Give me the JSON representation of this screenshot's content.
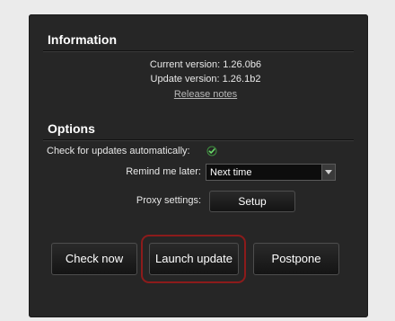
{
  "information": {
    "title": "Information",
    "current_version": "Current version: 1.26.0b6",
    "update_version": "Update version: 1.26.1b2",
    "release_notes": "Release notes"
  },
  "options": {
    "title": "Options",
    "auto_check_label": "Check for updates automatically:",
    "auto_check_checked": true,
    "remind_label": "Remind me later:",
    "remind_value": "Next time",
    "proxy_label": "Proxy settings:",
    "setup_button": "Setup"
  },
  "buttons": {
    "check_now": "Check now",
    "launch_update": "Launch update",
    "postpone": "Postpone"
  },
  "colors": {
    "panel_bg": "#262626",
    "check_green": "#5fd35f",
    "highlight_ring": "#8c1b1b"
  },
  "icons": {
    "checkbox": "checkmark-icon",
    "dropdown": "triangle-down-icon"
  }
}
